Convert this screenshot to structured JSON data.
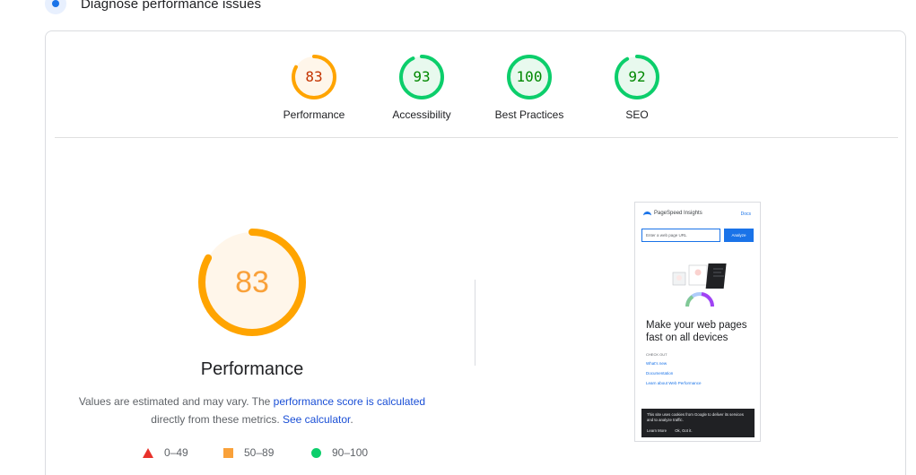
{
  "section": {
    "title": "Diagnose performance issues"
  },
  "categories": [
    {
      "label": "Performance",
      "score": "83",
      "fraction": 0.83,
      "status": "orange"
    },
    {
      "label": "Accessibility",
      "score": "93",
      "fraction": 0.93,
      "status": "green"
    },
    {
      "label": "Best Practices",
      "score": "100",
      "fraction": 1.0,
      "status": "green"
    },
    {
      "label": "SEO",
      "score": "92",
      "fraction": 0.92,
      "status": "green"
    }
  ],
  "main": {
    "score": "83",
    "fraction": 0.83,
    "title": "Performance",
    "desc_prefix": "Values are estimated and may vary. The ",
    "desc_link": "performance score is calculated",
    "desc_middle": "directly from these metrics. ",
    "desc_calc": "See calculator",
    "desc_end": "."
  },
  "legend": [
    {
      "shape": "triangle",
      "range": "0–49",
      "color": "#e8322b"
    },
    {
      "shape": "square",
      "range": "50–89",
      "color": "#f9a13a"
    },
    {
      "shape": "circle",
      "range": "90–100",
      "color": "#0cce6b"
    }
  ],
  "thumbnail": {
    "brand": "PageSpeed Insights",
    "docs": "Docs",
    "placeholder": "Enter a web page URL",
    "analyze": "Analyze",
    "headline": "Make your web pages fast on all devices",
    "check_out": "CHECK OUT",
    "links": [
      "What's new",
      "Documentation",
      "Learn about Web Performance"
    ],
    "cookie_text": "This site uses cookies from Google to deliver its services and to analyze traffic.",
    "cookie_learn": "Learn More",
    "cookie_ok": "Ok, Got it."
  },
  "colors": {
    "orange": "#ffa400",
    "orange_bg": "#fff6ea",
    "green": "#0cce6b",
    "green_bg": "#e8f9ee",
    "link": "#1a4fd6"
  }
}
